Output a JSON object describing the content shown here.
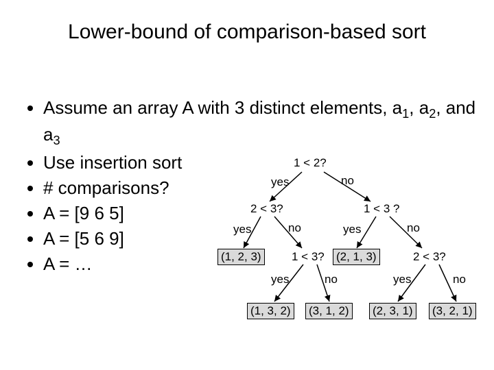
{
  "title": "Lower-bound of comparison-based sort",
  "bullets": {
    "b1_pre": "Assume an array A with 3 distinct elements, a",
    "b1_s1": "1",
    "b1_m1": ", a",
    "b1_s2": "2",
    "b1_m2": ", and a",
    "b1_s3": "3",
    "b2": "Use insertion sort",
    "b3": "# comparisons?",
    "b4": "A = [9 6 5]",
    "b5": "A = [5 6 9]",
    "b6": "A = …"
  },
  "tree": {
    "root": "1 < 2?",
    "root_yes": "yes",
    "root_no": "no",
    "L": "2 < 3?",
    "R": "1 < 3 ?",
    "L_yes": "yes",
    "L_no": "no",
    "R_yes": "yes",
    "R_no": "no",
    "LL_leaf": "(1, 2, 3)",
    "LR": "1 < 3?",
    "RL_leaf": "(2, 1, 3)",
    "RR": "2 < 3?",
    "LR_yes": "yes",
    "LR_no": "no",
    "RR_yes": "yes",
    "RR_no": "no",
    "leaf_LRy": "(1, 3, 2)",
    "leaf_LRn": "(3, 1, 2)",
    "leaf_RRy": "(2, 3, 1)",
    "leaf_RRn": "(3, 2, 1)"
  }
}
